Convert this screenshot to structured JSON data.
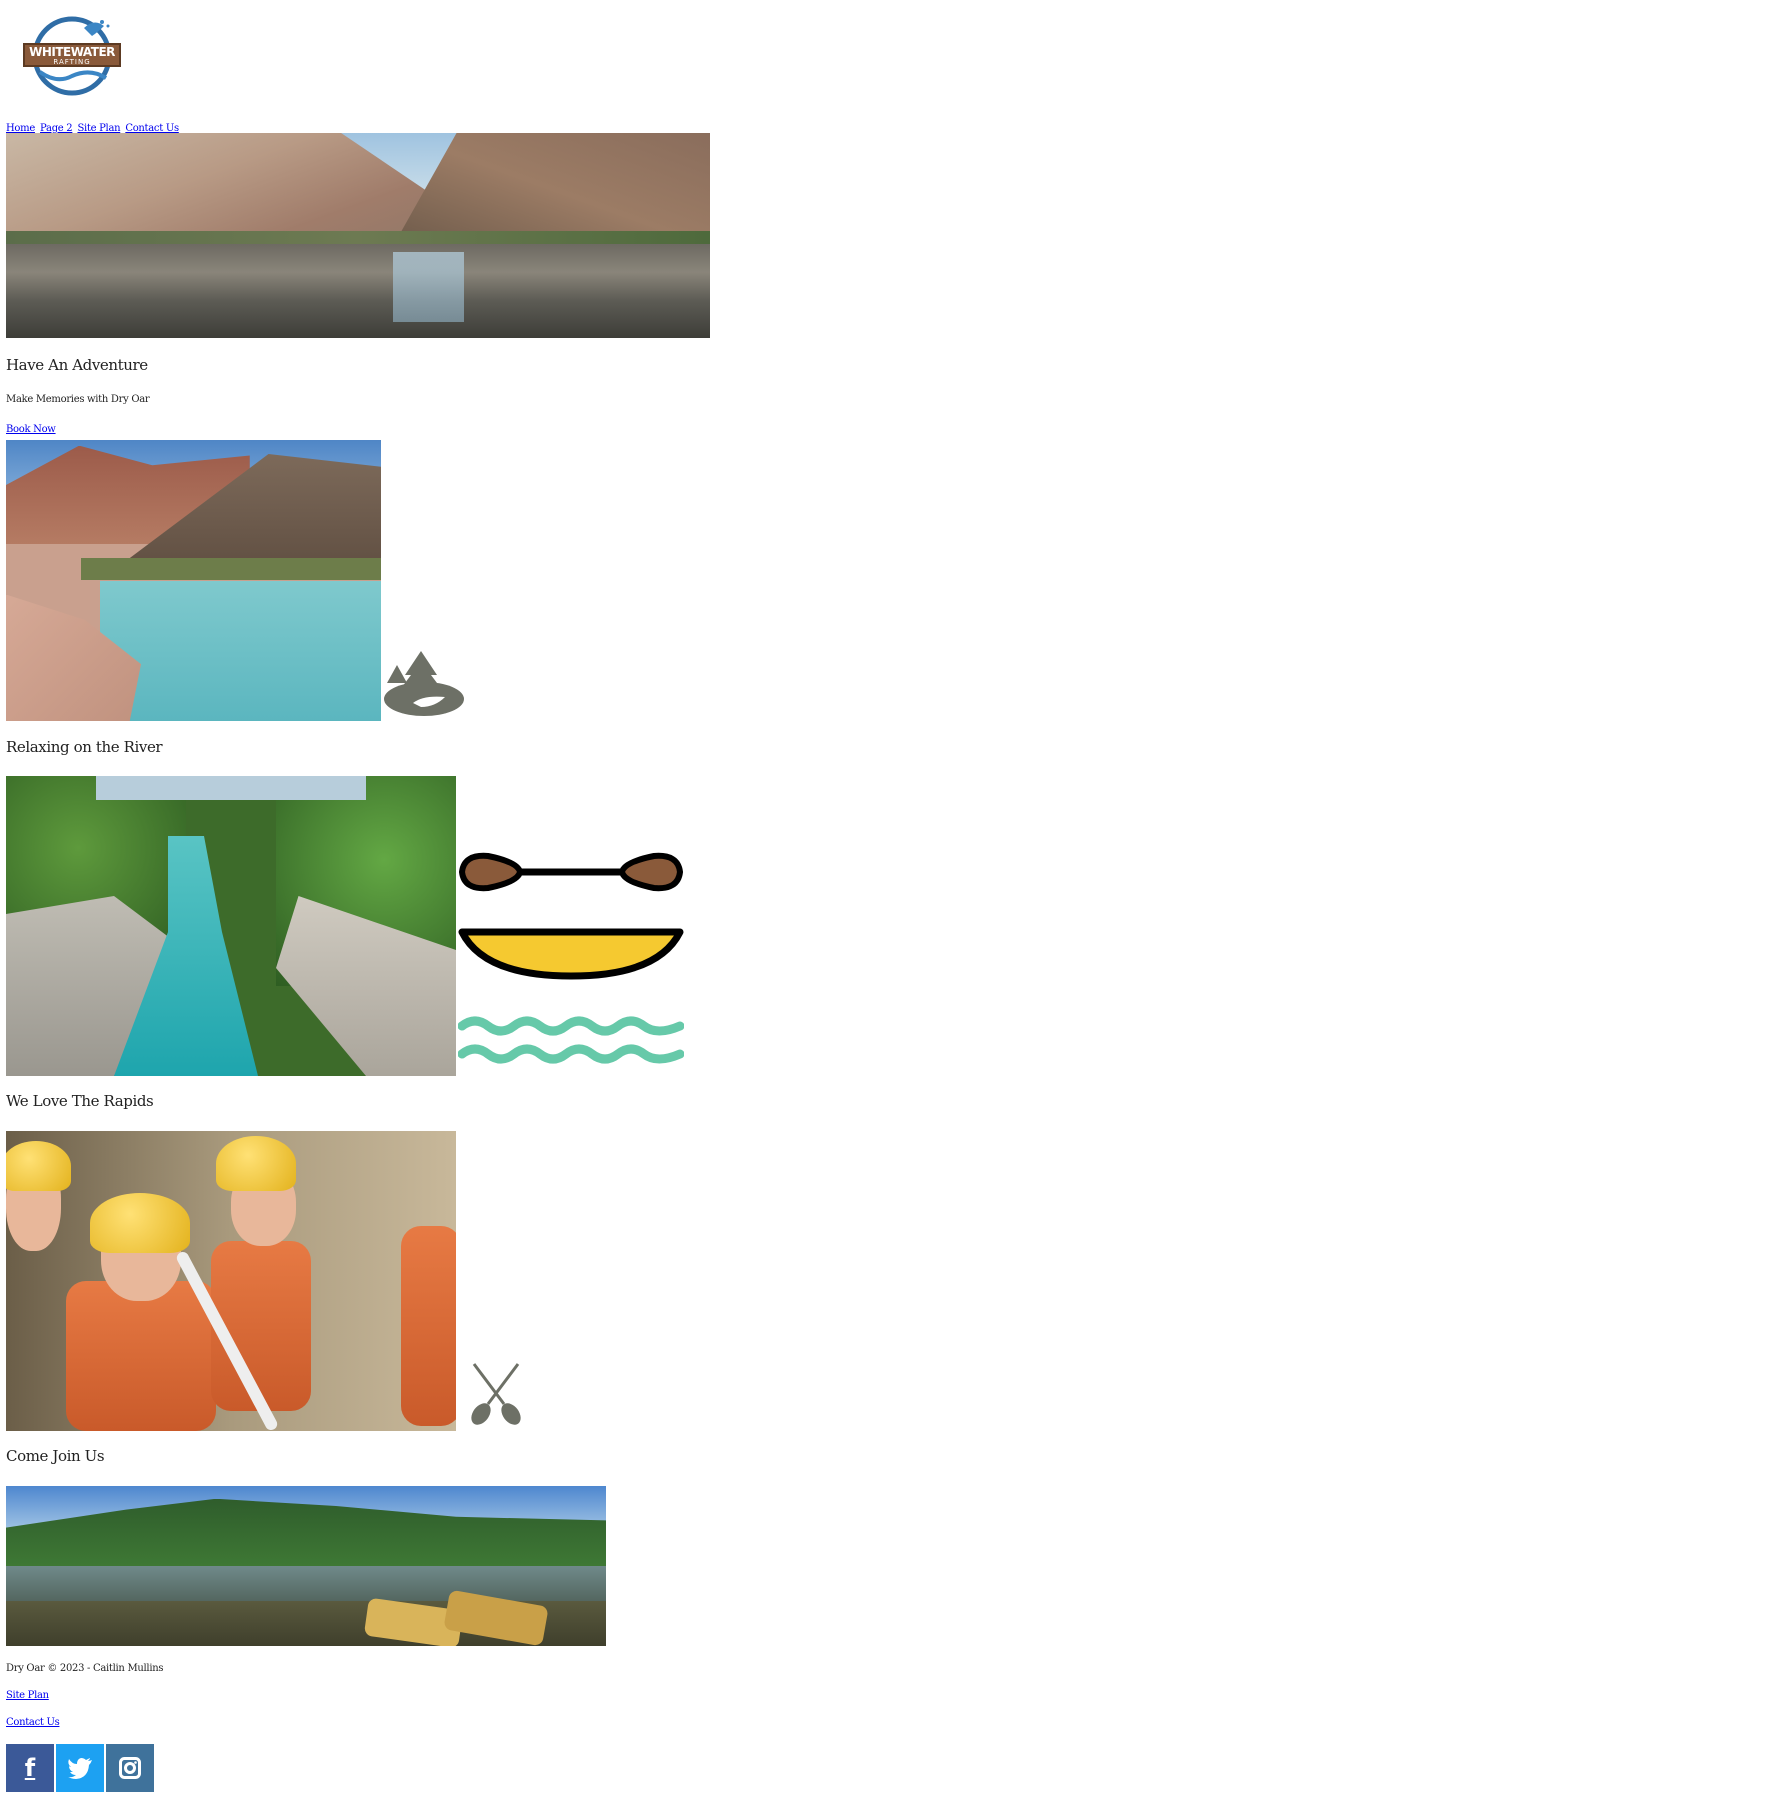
{
  "logo": {
    "line1": "WHITEWATER",
    "line2": "RAFTING",
    "colors": {
      "ring": "#2f6da6",
      "banner": "#8a5a3a",
      "splash": "#3b86c5"
    }
  },
  "nav": {
    "items": [
      "Home",
      "Page 2",
      "Site Plan",
      "Contact Us"
    ]
  },
  "hero": {
    "heading": "Have An Adventure",
    "tagline": "Make Memories with Dry Oar",
    "cta": "Book Now"
  },
  "sections": [
    {
      "heading": "Relaxing on the River",
      "icon": "forest-island-icon"
    },
    {
      "heading": "We Love The Rapids",
      "icon": "kayak-paddle-waves-icon"
    },
    {
      "heading": "Come Join Us",
      "icon": "crossed-oars-icon"
    }
  ],
  "footer": {
    "copyright": "Dry Oar © 2023 - Caitlin Mullins",
    "links": [
      "Site Plan",
      "Contact Us"
    ],
    "social": [
      {
        "name": "facebook",
        "glyph": "f",
        "color": "#3b5998"
      },
      {
        "name": "twitter",
        "glyph": "t",
        "color": "#1da1f2"
      },
      {
        "name": "instagram",
        "glyph": "◎",
        "color": "#3f729b"
      }
    ]
  },
  "colors": {
    "link": "#0000ee",
    "icon_gray": "#6d7066",
    "kayak_yellow": "#f5c930",
    "paddle_brown": "#8a5a3a",
    "wave_teal": "#66c9a9"
  }
}
